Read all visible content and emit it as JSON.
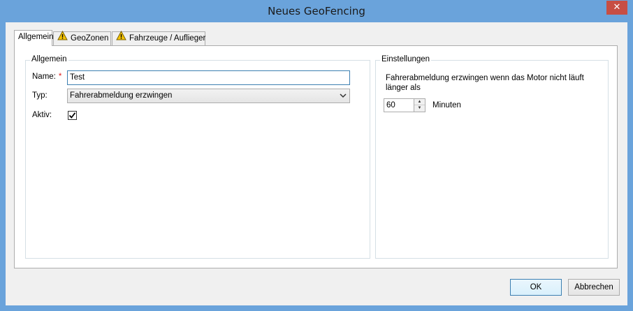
{
  "window": {
    "title": "Neues GeoFencing",
    "close_glyph": "✕"
  },
  "tabs": [
    {
      "label": "Allgemein",
      "warning": false,
      "icon": ""
    },
    {
      "label": "GeoZonen",
      "warning": true,
      "icon": "warning-icon"
    },
    {
      "label": "Fahrzeuge / Auflieger",
      "warning": true,
      "icon": "warning-icon"
    }
  ],
  "general": {
    "group_title": "Allgemein",
    "name_label": "Name:",
    "required_marker": "*",
    "name_value": "Test",
    "type_label": "Typ:",
    "type_value": "Fahrerabmeldung erzwingen",
    "active_label": "Aktiv:",
    "active_checked": true
  },
  "settings": {
    "group_title": "Einstellungen",
    "description": "Fahrerabmeldung erzwingen wenn das Motor nicht läuft länger als",
    "minutes_value": "60",
    "minutes_unit": "Minuten"
  },
  "footer": {
    "ok_label": "OK",
    "cancel_label": "Abbrechen"
  },
  "colors": {
    "titlebar": "#6aa3db",
    "close": "#c74e44",
    "focus_border": "#3c7fb1",
    "warning": "#f5c400"
  }
}
